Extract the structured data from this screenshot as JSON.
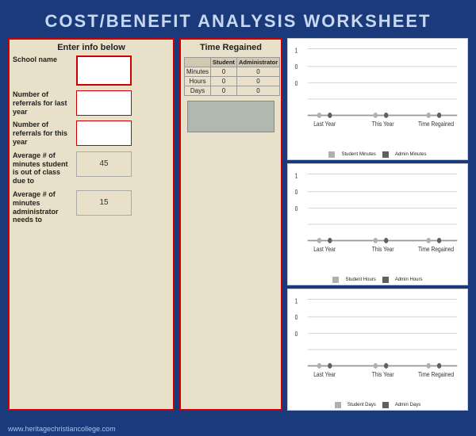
{
  "title": "COST/BENEFIT ANALYSIS WORKSHEET",
  "left_panel": {
    "title": "Enter info below",
    "fields": [
      {
        "label": "School name",
        "value": "",
        "type": "input"
      },
      {
        "label": "Number of referrals for last year",
        "value": "",
        "type": "input"
      },
      {
        "label": "Number of referrals for this year",
        "value": "",
        "type": "input"
      },
      {
        "label": "Average # of minutes student is out of class due to",
        "value": "45",
        "type": "display"
      },
      {
        "label": "Average # of minutes administrator needs to",
        "value": "15",
        "type": "display"
      }
    ]
  },
  "middle_panel": {
    "title": "Time Regained",
    "table": {
      "headers": [
        "",
        "Student",
        "Administrator"
      ],
      "rows": [
        {
          "label": "Minutes",
          "student": "0",
          "admin": "0"
        },
        {
          "label": "Hours",
          "student": "0",
          "admin": "0"
        },
        {
          "label": "Days",
          "student": "0",
          "admin": "0"
        }
      ]
    }
  },
  "charts": [
    {
      "id": "minutes-chart",
      "legend": [
        {
          "label": "Student Minutes",
          "color": "#b0b0b0"
        },
        {
          "label": "Admin Minutes",
          "color": "#606060"
        }
      ],
      "x_labels": [
        "Last Year",
        "This Year",
        "Time Regained"
      ],
      "y_max": 1,
      "series": [
        {
          "name": "Student",
          "values": [
            0,
            0,
            0
          ]
        },
        {
          "name": "Admin",
          "values": [
            0,
            0,
            0
          ]
        }
      ]
    },
    {
      "id": "hours-chart",
      "legend": [
        {
          "label": "Student Hours",
          "color": "#b0b0b0"
        },
        {
          "label": "Admin Hours",
          "color": "#606060"
        }
      ],
      "x_labels": [
        "Last Year",
        "This Year",
        "Time Regained"
      ],
      "y_max": 1,
      "series": [
        {
          "name": "Student",
          "values": [
            0,
            0,
            0
          ]
        },
        {
          "name": "Admin",
          "values": [
            0,
            0,
            0
          ]
        }
      ]
    },
    {
      "id": "days-chart",
      "legend": [
        {
          "label": "Student Days",
          "color": "#b0b0b0"
        },
        {
          "label": "Admin Days",
          "color": "#606060"
        }
      ],
      "x_labels": [
        "Last Year",
        "This Year",
        "Time Regained"
      ],
      "y_max": 1,
      "series": [
        {
          "name": "Student",
          "values": [
            0,
            0,
            0
          ]
        },
        {
          "name": "Admin",
          "values": [
            0,
            0,
            0
          ]
        }
      ]
    }
  ],
  "footer": {
    "url": "www.heritagechristiancollege.com"
  }
}
